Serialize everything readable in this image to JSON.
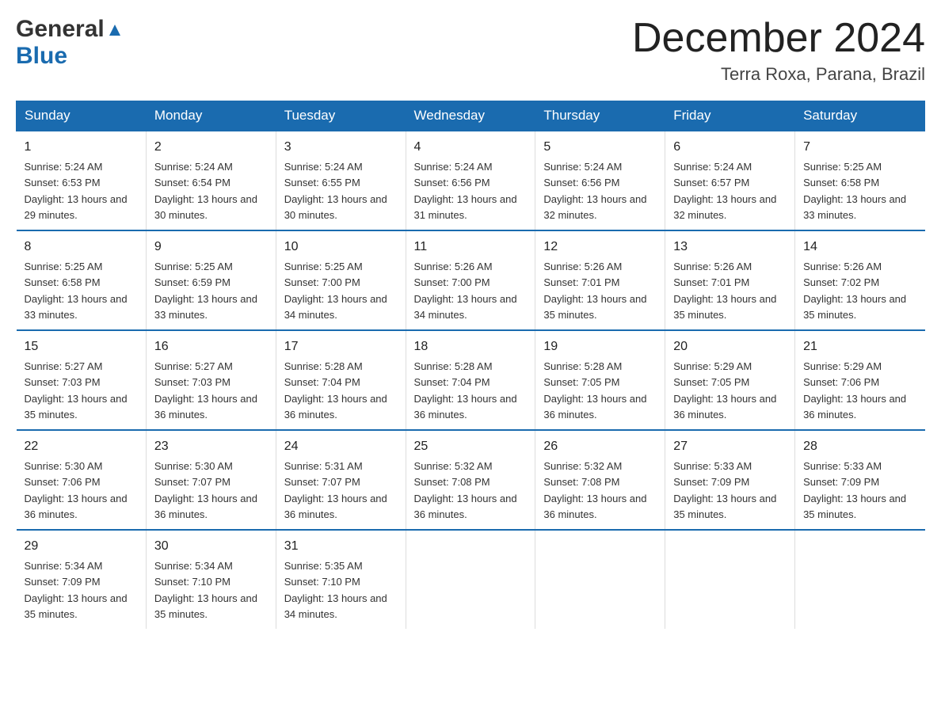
{
  "logo": {
    "general": "General",
    "blue": "Blue"
  },
  "title": {
    "month": "December 2024",
    "location": "Terra Roxa, Parana, Brazil"
  },
  "headers": [
    "Sunday",
    "Monday",
    "Tuesday",
    "Wednesday",
    "Thursday",
    "Friday",
    "Saturday"
  ],
  "weeks": [
    [
      {
        "day": "1",
        "sunrise": "5:24 AM",
        "sunset": "6:53 PM",
        "daylight": "13 hours and 29 minutes."
      },
      {
        "day": "2",
        "sunrise": "5:24 AM",
        "sunset": "6:54 PM",
        "daylight": "13 hours and 30 minutes."
      },
      {
        "day": "3",
        "sunrise": "5:24 AM",
        "sunset": "6:55 PM",
        "daylight": "13 hours and 30 minutes."
      },
      {
        "day": "4",
        "sunrise": "5:24 AM",
        "sunset": "6:56 PM",
        "daylight": "13 hours and 31 minutes."
      },
      {
        "day": "5",
        "sunrise": "5:24 AM",
        "sunset": "6:56 PM",
        "daylight": "13 hours and 32 minutes."
      },
      {
        "day": "6",
        "sunrise": "5:24 AM",
        "sunset": "6:57 PM",
        "daylight": "13 hours and 32 minutes."
      },
      {
        "day": "7",
        "sunrise": "5:25 AM",
        "sunset": "6:58 PM",
        "daylight": "13 hours and 33 minutes."
      }
    ],
    [
      {
        "day": "8",
        "sunrise": "5:25 AM",
        "sunset": "6:58 PM",
        "daylight": "13 hours and 33 minutes."
      },
      {
        "day": "9",
        "sunrise": "5:25 AM",
        "sunset": "6:59 PM",
        "daylight": "13 hours and 33 minutes."
      },
      {
        "day": "10",
        "sunrise": "5:25 AM",
        "sunset": "7:00 PM",
        "daylight": "13 hours and 34 minutes."
      },
      {
        "day": "11",
        "sunrise": "5:26 AM",
        "sunset": "7:00 PM",
        "daylight": "13 hours and 34 minutes."
      },
      {
        "day": "12",
        "sunrise": "5:26 AM",
        "sunset": "7:01 PM",
        "daylight": "13 hours and 35 minutes."
      },
      {
        "day": "13",
        "sunrise": "5:26 AM",
        "sunset": "7:01 PM",
        "daylight": "13 hours and 35 minutes."
      },
      {
        "day": "14",
        "sunrise": "5:26 AM",
        "sunset": "7:02 PM",
        "daylight": "13 hours and 35 minutes."
      }
    ],
    [
      {
        "day": "15",
        "sunrise": "5:27 AM",
        "sunset": "7:03 PM",
        "daylight": "13 hours and 35 minutes."
      },
      {
        "day": "16",
        "sunrise": "5:27 AM",
        "sunset": "7:03 PM",
        "daylight": "13 hours and 36 minutes."
      },
      {
        "day": "17",
        "sunrise": "5:28 AM",
        "sunset": "7:04 PM",
        "daylight": "13 hours and 36 minutes."
      },
      {
        "day": "18",
        "sunrise": "5:28 AM",
        "sunset": "7:04 PM",
        "daylight": "13 hours and 36 minutes."
      },
      {
        "day": "19",
        "sunrise": "5:28 AM",
        "sunset": "7:05 PM",
        "daylight": "13 hours and 36 minutes."
      },
      {
        "day": "20",
        "sunrise": "5:29 AM",
        "sunset": "7:05 PM",
        "daylight": "13 hours and 36 minutes."
      },
      {
        "day": "21",
        "sunrise": "5:29 AM",
        "sunset": "7:06 PM",
        "daylight": "13 hours and 36 minutes."
      }
    ],
    [
      {
        "day": "22",
        "sunrise": "5:30 AM",
        "sunset": "7:06 PM",
        "daylight": "13 hours and 36 minutes."
      },
      {
        "day": "23",
        "sunrise": "5:30 AM",
        "sunset": "7:07 PM",
        "daylight": "13 hours and 36 minutes."
      },
      {
        "day": "24",
        "sunrise": "5:31 AM",
        "sunset": "7:07 PM",
        "daylight": "13 hours and 36 minutes."
      },
      {
        "day": "25",
        "sunrise": "5:32 AM",
        "sunset": "7:08 PM",
        "daylight": "13 hours and 36 minutes."
      },
      {
        "day": "26",
        "sunrise": "5:32 AM",
        "sunset": "7:08 PM",
        "daylight": "13 hours and 36 minutes."
      },
      {
        "day": "27",
        "sunrise": "5:33 AM",
        "sunset": "7:09 PM",
        "daylight": "13 hours and 35 minutes."
      },
      {
        "day": "28",
        "sunrise": "5:33 AM",
        "sunset": "7:09 PM",
        "daylight": "13 hours and 35 minutes."
      }
    ],
    [
      {
        "day": "29",
        "sunrise": "5:34 AM",
        "sunset": "7:09 PM",
        "daylight": "13 hours and 35 minutes."
      },
      {
        "day": "30",
        "sunrise": "5:34 AM",
        "sunset": "7:10 PM",
        "daylight": "13 hours and 35 minutes."
      },
      {
        "day": "31",
        "sunrise": "5:35 AM",
        "sunset": "7:10 PM",
        "daylight": "13 hours and 34 minutes."
      },
      null,
      null,
      null,
      null
    ]
  ]
}
